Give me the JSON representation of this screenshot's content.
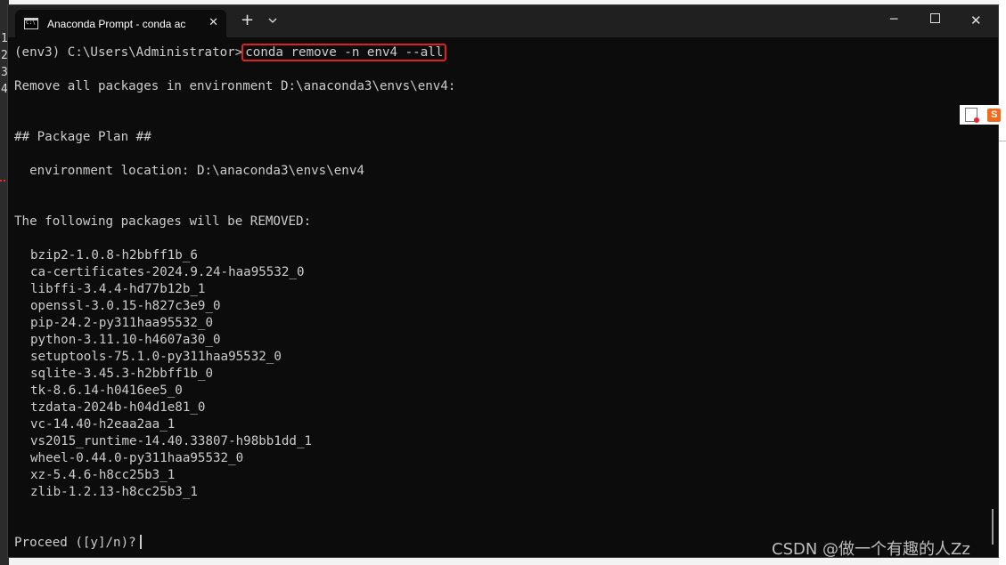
{
  "background_editor": {
    "line_numbers": [
      "1",
      "2",
      "3",
      "4"
    ]
  },
  "window": {
    "tab_title": "Anaconda Prompt - conda ac",
    "tab_close": "✕",
    "new_tab": "+",
    "dropdown": "⌄",
    "minimize": "─",
    "close": "✕"
  },
  "terminal": {
    "prompt": "(env3) C:\\Users\\Administrator>",
    "command": "conda remove -n env4 --all",
    "remove_msg": "Remove all packages in environment D:\\anaconda3\\envs\\env4:",
    "plan_header": "## Package Plan ##",
    "env_location": "  environment location: D:\\anaconda3\\envs\\env4",
    "removed_header": "The following packages will be REMOVED:",
    "packages": [
      "bzip2-1.0.8-h2bbff1b_6",
      "ca-certificates-2024.9.24-haa95532_0",
      "libffi-3.4.4-hd77b12b_1",
      "openssl-3.0.15-h827c3e9_0",
      "pip-24.2-py311haa95532_0",
      "python-3.11.10-h4607a30_0",
      "setuptools-75.1.0-py311haa95532_0",
      "sqlite-3.45.3-h2bbff1b_0",
      "tk-8.6.14-h0416ee5_0",
      "tzdata-2024b-h04d1e81_0",
      "vc-14.40-h2eaa2aa_1",
      "vs2015_runtime-14.40.33807-h98bb1dd_1",
      "wheel-0.44.0-py311haa95532_0",
      "xz-5.4.6-h8cc25b3_1",
      "zlib-1.2.13-h8cc25b3_1"
    ],
    "proceed_prompt": "Proceed ([y]/n)?"
  },
  "float_icons": {
    "s_label": "S"
  },
  "watermark": "CSDN @做一个有趣的人Zz"
}
